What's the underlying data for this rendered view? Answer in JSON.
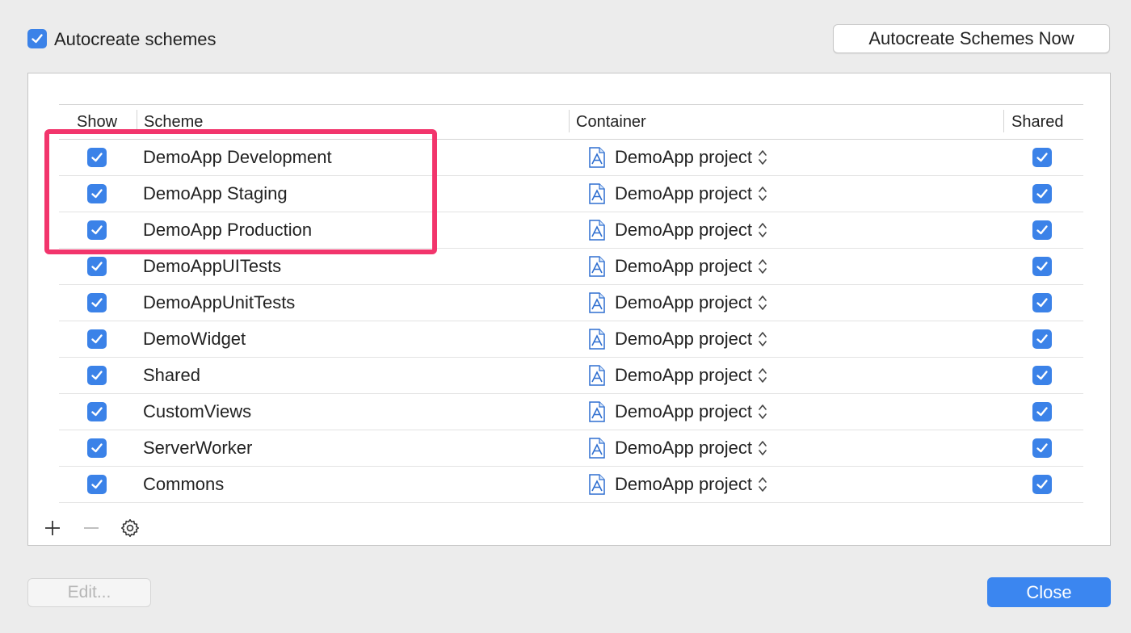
{
  "header": {
    "autocreate_checkbox_label": "Autocreate schemes",
    "autocreate_now_button": "Autocreate Schemes Now"
  },
  "table": {
    "columns": [
      "Show",
      "Scheme",
      "Container",
      "Shared"
    ],
    "rows": [
      {
        "show": true,
        "scheme": "DemoApp Development",
        "container": "DemoApp project",
        "shared": true
      },
      {
        "show": true,
        "scheme": "DemoApp Staging",
        "container": "DemoApp project",
        "shared": true
      },
      {
        "show": true,
        "scheme": "DemoApp Production",
        "container": "DemoApp project",
        "shared": true
      },
      {
        "show": true,
        "scheme": "DemoAppUITests",
        "container": "DemoApp project",
        "shared": true
      },
      {
        "show": true,
        "scheme": "DemoAppUnitTests",
        "container": "DemoApp project",
        "shared": true
      },
      {
        "show": true,
        "scheme": "DemoWidget",
        "container": "DemoApp project",
        "shared": true
      },
      {
        "show": true,
        "scheme": "Shared",
        "container": "DemoApp project",
        "shared": true
      },
      {
        "show": true,
        "scheme": "CustomViews",
        "container": "DemoApp project",
        "shared": true
      },
      {
        "show": true,
        "scheme": "ServerWorker",
        "container": "DemoApp project",
        "shared": true
      },
      {
        "show": true,
        "scheme": "Commons",
        "container": "DemoApp project",
        "shared": true
      }
    ]
  },
  "tools": {
    "icons": [
      "plus-icon",
      "minus-icon",
      "gear-icon"
    ]
  },
  "footer": {
    "edit_button": "Edit...",
    "close_button": "Close"
  },
  "colors": {
    "accent": "#3b82e8",
    "highlight": "#f2356c"
  }
}
